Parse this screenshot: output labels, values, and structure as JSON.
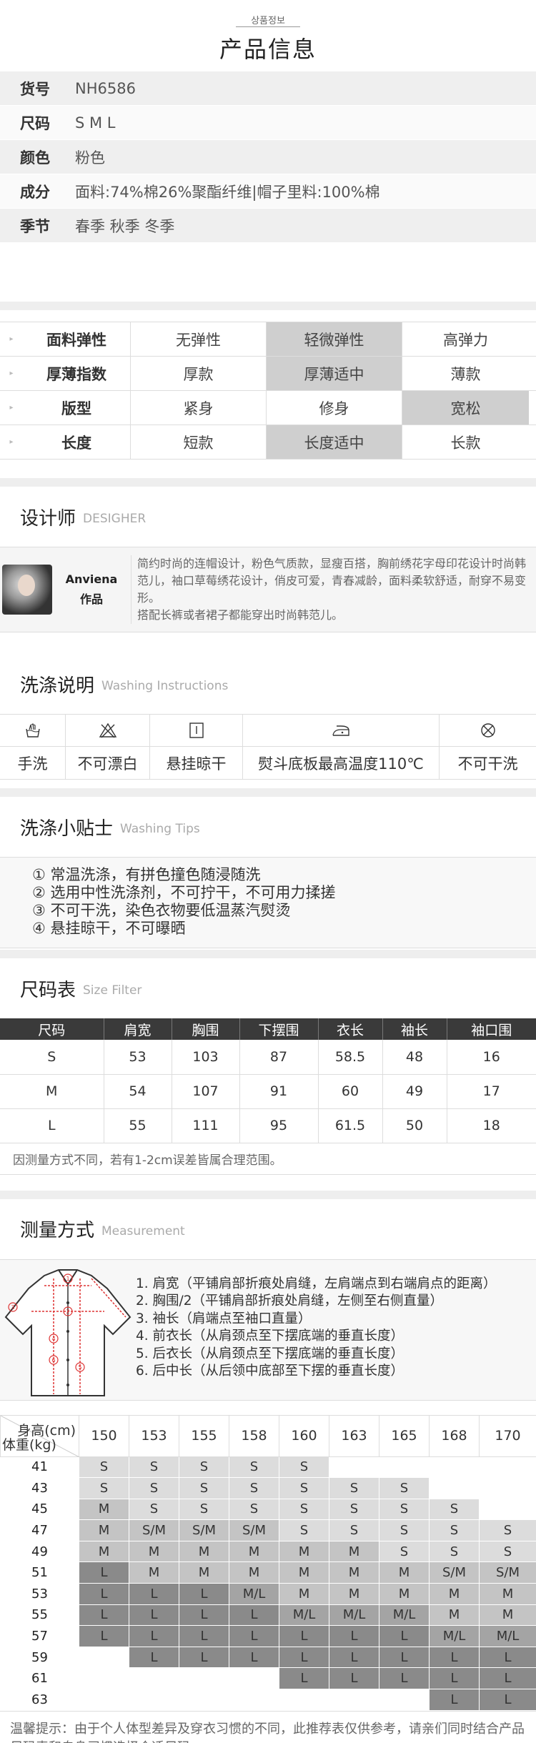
{
  "header": {
    "subtitle": "상품정보",
    "title": "产品信息"
  },
  "product": [
    {
      "k": "货号",
      "v": "NH6586"
    },
    {
      "k": "尺码",
      "v": "S M L"
    },
    {
      "k": "颜色",
      "v": "粉色"
    },
    {
      "k": "成分",
      "v": "面料:74%棉26%聚酯纤维|帽子里料:100%棉"
    },
    {
      "k": "季节",
      "v": "春季 秋季 冬季"
    }
  ],
  "attributes": [
    {
      "label": "面料弹性",
      "options": [
        "无弹性",
        "轻微弹性",
        "高弹力"
      ],
      "selected": 1
    },
    {
      "label": "厚薄指数",
      "options": [
        "厚款",
        "厚薄适中",
        "薄款"
      ],
      "selected": 1
    },
    {
      "label": "版型",
      "options": [
        "紧身",
        "修身",
        "宽松"
      ],
      "selected": 2
    },
    {
      "label": "长度",
      "options": [
        "短款",
        "长度适中",
        "长款"
      ],
      "selected": 1
    }
  ],
  "designer": {
    "title": "设计师",
    "title_en": "DESIGHER",
    "name": "Anviena",
    "name_sub": "作品",
    "text1": "简约时尚的连帽设计，粉色气质款，显瘦百搭，胸前绣花字母印花设计时尚韩范儿，袖口草莓绣花设计，俏皮可爱，青春减龄，面料柔软舒适，耐穿不易变形。",
    "text2": "搭配长裤或者裙子都能穿出时尚韩范儿。"
  },
  "washing": {
    "title": "洗涤说明",
    "title_en": "Washing Instructions",
    "items": [
      {
        "label": "手洗",
        "icon": "hand-wash-icon"
      },
      {
        "label": "不可漂白",
        "icon": "no-bleach-icon"
      },
      {
        "label": "悬挂晾干",
        "icon": "hang-dry-icon"
      },
      {
        "label": "熨斗底板最高温度110℃",
        "icon": "iron-icon"
      },
      {
        "label": "不可干洗",
        "icon": "no-dry-clean-icon"
      }
    ]
  },
  "tips": {
    "title": "洗涤小贴士",
    "title_en": "Washing Tips",
    "items": [
      "① 常温洗涤，有拼色撞色随浸随洗",
      "② 选用中性洗涤剂，不可拧干，不可用力揉搓",
      "③ 不可干洗，染色衣物要低温蒸汽熨烫",
      "④ 悬挂晾干，不可曝晒"
    ]
  },
  "sizes": {
    "title": "尺码表",
    "title_en": "Size Filter",
    "headers": [
      "尺码",
      "肩宽",
      "胸围",
      "下摆围",
      "衣长",
      "袖长",
      "袖口围"
    ],
    "rows": [
      [
        "S",
        "53",
        "103",
        "87",
        "58.5",
        "48",
        "16"
      ],
      [
        "M",
        "54",
        "107",
        "91",
        "60",
        "49",
        "17"
      ],
      [
        "L",
        "55",
        "111",
        "95",
        "61.5",
        "50",
        "18"
      ]
    ],
    "note": "因测量方式不同，若有1-2cm误差皆属合理范围。"
  },
  "measure": {
    "title": "测量方式",
    "title_en": "Measurement",
    "items": [
      "1. 肩宽（平铺肩部折痕处肩缝，左肩端点到右端肩点的距离）",
      "2. 胸围/2（平铺肩部折痕处肩缝，左侧至右侧直量）",
      "3. 袖长（肩端点至袖口直量）",
      "4. 前衣长（从肩颈点至下摆底端的垂直长度）",
      "5. 后衣长（从肩颈点至下摆底端的垂直长度）",
      "6. 后中长（从后领中底部至下摆的垂直长度）"
    ]
  },
  "recommend": {
    "height_label": "身高(cm)",
    "weight_label": "体重(kg)",
    "heights": [
      "150",
      "153",
      "155",
      "158",
      "160",
      "163",
      "165",
      "168",
      "170"
    ],
    "rows": [
      {
        "w": "41",
        "c": [
          "S",
          "S",
          "S",
          "S",
          "S",
          "",
          "",
          "",
          ""
        ]
      },
      {
        "w": "43",
        "c": [
          "S",
          "S",
          "S",
          "S",
          "S",
          "S",
          "S",
          "",
          ""
        ]
      },
      {
        "w": "45",
        "c": [
          "M",
          "S",
          "S",
          "S",
          "S",
          "S",
          "S",
          "S",
          ""
        ]
      },
      {
        "w": "47",
        "c": [
          "M",
          "S/M",
          "S/M",
          "S/M",
          "S",
          "S",
          "S",
          "S",
          "S"
        ]
      },
      {
        "w": "49",
        "c": [
          "M",
          "M",
          "M",
          "M",
          "M",
          "M",
          "S",
          "S",
          "S"
        ]
      },
      {
        "w": "51",
        "c": [
          "L",
          "M",
          "M",
          "M",
          "M",
          "M",
          "M",
          "S/M",
          "S/M"
        ]
      },
      {
        "w": "53",
        "c": [
          "L",
          "L",
          "L",
          "M/L",
          "M",
          "M",
          "M",
          "M",
          "M"
        ]
      },
      {
        "w": "55",
        "c": [
          "L",
          "L",
          "L",
          "L",
          "M/L",
          "M/L",
          "M/L",
          "M",
          "M"
        ]
      },
      {
        "w": "57",
        "c": [
          "L",
          "L",
          "L",
          "L",
          "L",
          "L",
          "L",
          "M/L",
          "M/L"
        ]
      },
      {
        "w": "59",
        "c": [
          "",
          "L",
          "L",
          "L",
          "L",
          "L",
          "L",
          "L",
          "L"
        ]
      },
      {
        "w": "61",
        "c": [
          "",
          "",
          "",
          "",
          "L",
          "L",
          "L",
          "L",
          "L"
        ]
      },
      {
        "w": "63",
        "c": [
          "",
          "",
          "",
          "",
          "",
          "",
          "",
          "L",
          "L"
        ]
      }
    ],
    "warm": "温馨提示：由于个人体型差异及穿衣习惯的不同，此推荐表仅供参考，请亲们同时结合产品尺码表和自身习惯选择合适尺码。"
  }
}
